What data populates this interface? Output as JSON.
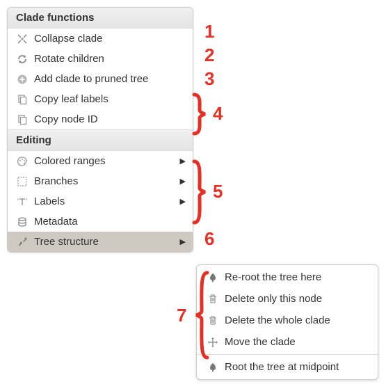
{
  "menu": {
    "section1": {
      "title": "Clade functions"
    },
    "section2": {
      "title": "Editing"
    },
    "items": {
      "collapse": "Collapse clade",
      "rotate": "Rotate children",
      "addPruned": "Add clade to pruned tree",
      "copyLeaf": "Copy leaf labels",
      "copyNode": "Copy node ID",
      "coloredRanges": "Colored ranges",
      "branches": "Branches",
      "labels": "Labels",
      "metadata": "Metadata",
      "treeStructure": "Tree structure"
    }
  },
  "submenu": {
    "reroot": "Re-root the tree here",
    "deleteNode": "Delete only this node",
    "deleteClade": "Delete the whole clade",
    "moveClade": "Move the clade",
    "rootMidpoint": "Root the tree at midpoint"
  },
  "annotations": {
    "n1": "1",
    "n2": "2",
    "n3": "3",
    "n4": "4",
    "n5": "5",
    "n6": "6",
    "n7": "7"
  }
}
